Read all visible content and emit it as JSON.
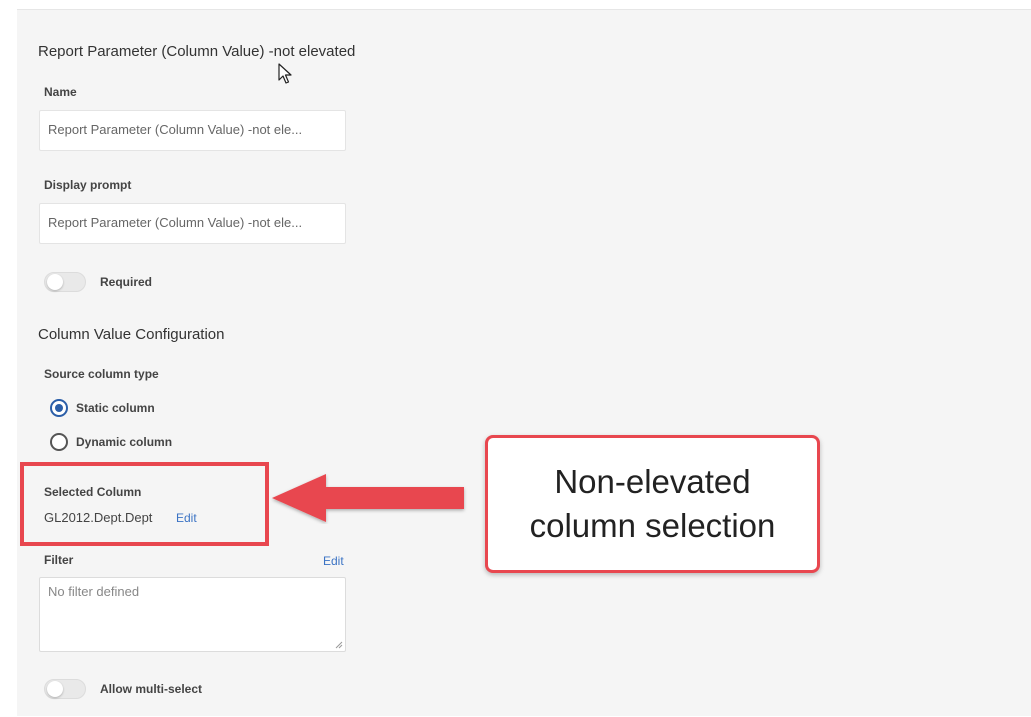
{
  "form": {
    "title": "Report Parameter (Column Value) -not elevated",
    "name_label": "Name",
    "name_value": "Report Parameter (Column Value) -not ele...",
    "prompt_label": "Display prompt",
    "prompt_value": "Report Parameter (Column Value) -not ele...",
    "required_label": "Required",
    "required_on": false
  },
  "config": {
    "section_title": "Column Value Configuration",
    "source_type_label": "Source column type",
    "options": [
      {
        "label": "Static column",
        "selected": true
      },
      {
        "label": "Dynamic column",
        "selected": false
      }
    ],
    "selected_column_label": "Selected Column",
    "selected_column_value": "GL2012.Dept.Dept",
    "selected_column_edit": "Edit",
    "filter_label": "Filter",
    "filter_edit": "Edit",
    "filter_placeholder": "No filter defined",
    "multiselect_label": "Allow multi-select",
    "multiselect_on": false
  },
  "annotation": {
    "line1": "Non-elevated",
    "line2": "column selection",
    "color": "#e8474f"
  }
}
